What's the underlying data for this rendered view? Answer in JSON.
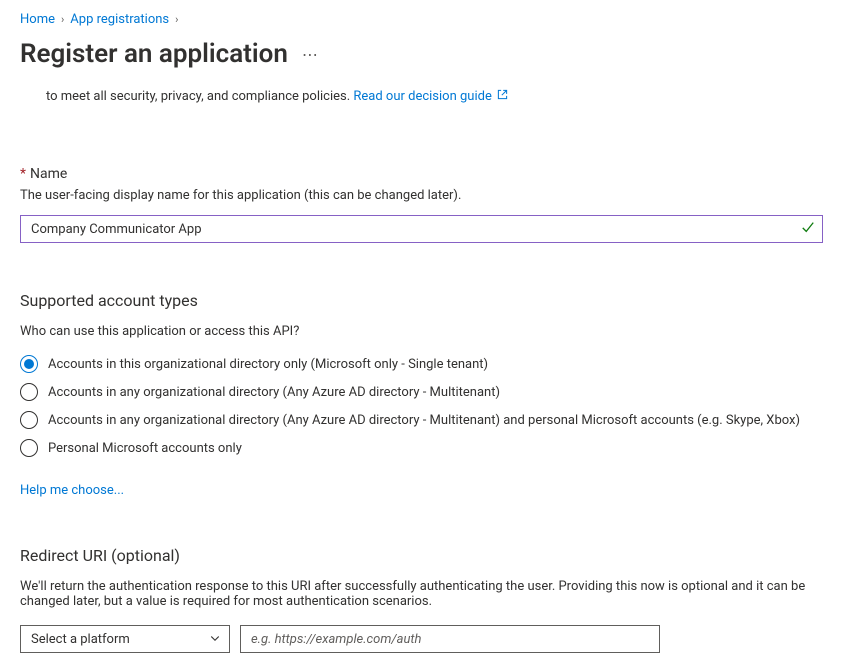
{
  "breadcrumb": {
    "home": "Home",
    "app_regs": "App registrations"
  },
  "title": "Register an application",
  "intro": {
    "text": "to meet all security, privacy, and compliance policies. ",
    "link": "Read our decision guide"
  },
  "name": {
    "label": "Name",
    "help": "The user-facing display name for this application (this can be changed later).",
    "value": "Company Communicator App"
  },
  "account_types": {
    "heading": "Supported account types",
    "question": "Who can use this application or access this API?",
    "options": [
      "Accounts in this organizational directory only (Microsoft only - Single tenant)",
      "Accounts in any organizational directory (Any Azure AD directory - Multitenant)",
      "Accounts in any organizational directory (Any Azure AD directory - Multitenant) and personal Microsoft accounts (e.g. Skype, Xbox)",
      "Personal Microsoft accounts only"
    ],
    "selected": 0,
    "help_link": "Help me choose..."
  },
  "redirect": {
    "heading": "Redirect URI (optional)",
    "desc": "We'll return the authentication response to this URI after successfully authenticating the user. Providing this now is optional and it can be changed later, but a value is required for most authentication scenarios.",
    "select_placeholder": "Select a platform",
    "input_placeholder": "e.g. https://example.com/auth"
  }
}
